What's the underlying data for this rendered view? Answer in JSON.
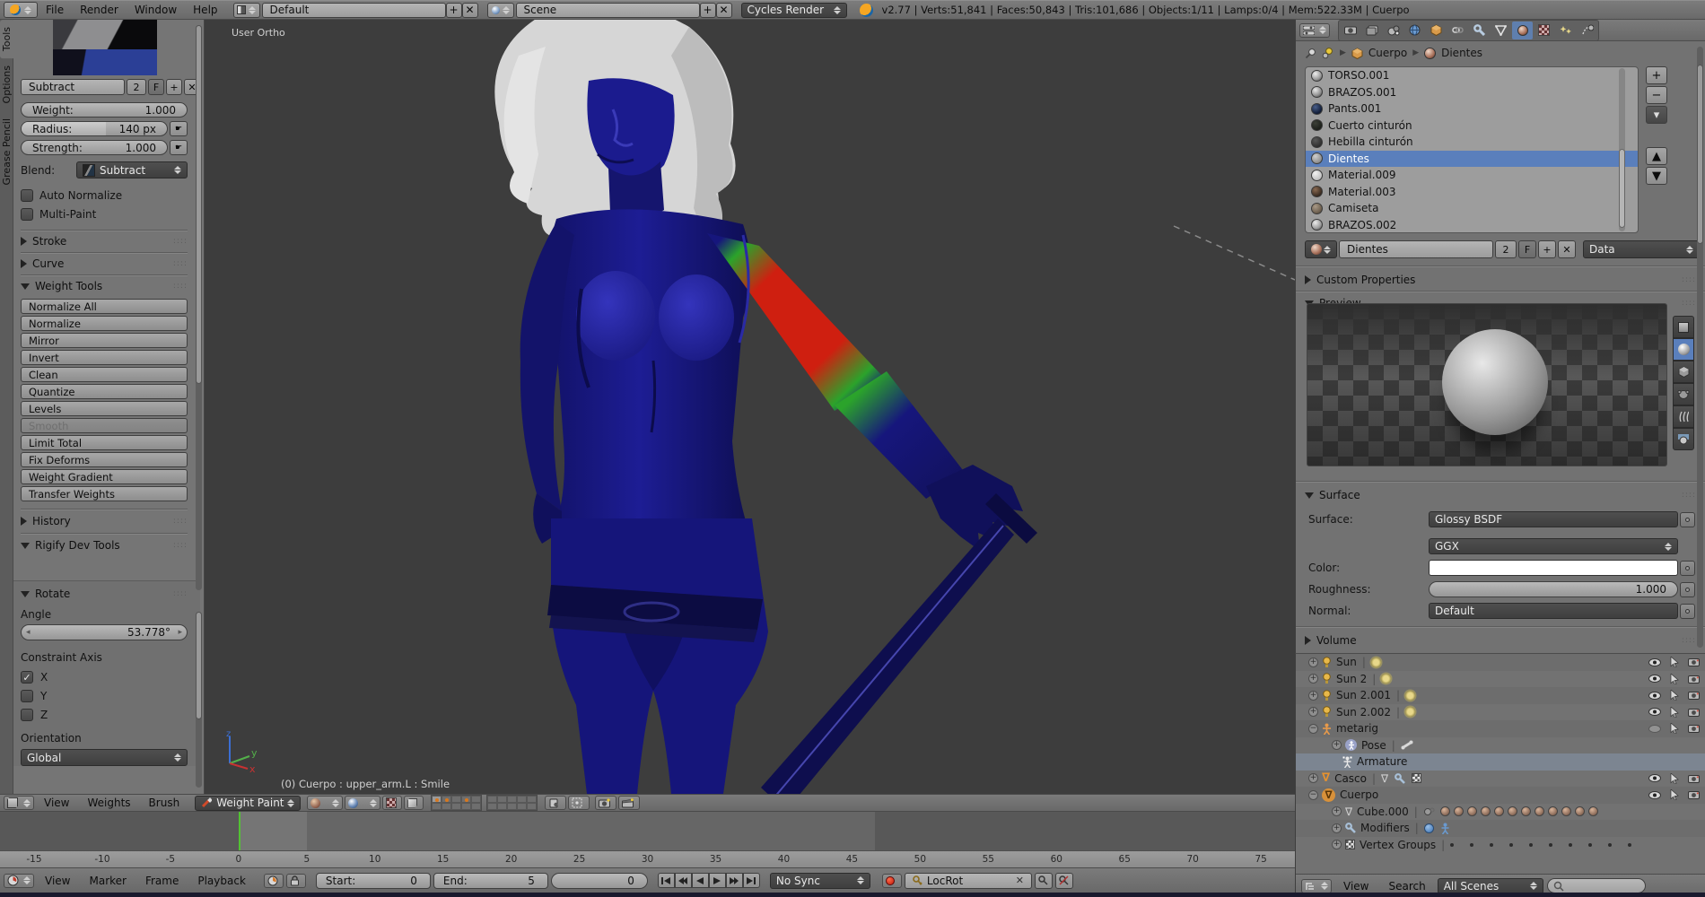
{
  "window": {
    "menus": [
      "File",
      "Render",
      "Window",
      "Help"
    ],
    "layout": "Default",
    "scene": "Scene",
    "engine": "Cycles Render",
    "stats": "v2.77 | Verts:51,841 | Faces:50,843 | Tris:101,686 | Objects:1/11 | Lamps:0/4 | Mem:522.33M | Cuerpo"
  },
  "tool_shelf": {
    "tabs": [
      "Tools",
      "Options",
      "Grease Pencil"
    ],
    "brush": {
      "name": "Subtract",
      "count": "2",
      "fake": "F",
      "weight_label": "Weight:",
      "weight": "1.000",
      "radius_label": "Radius:",
      "radius": "140 px",
      "strength_label": "Strength:",
      "strength": "1.000",
      "blend_label": "Blend:",
      "blend": "Subtract"
    },
    "auto_normalize": "Auto Normalize",
    "multi_paint": "Multi-Paint",
    "stroke": "Stroke",
    "curve": "Curve",
    "weight_tools": "Weight Tools",
    "buttons": [
      {
        "label": "Normalize All"
      },
      {
        "label": "Normalize"
      },
      {
        "label": "Mirror"
      },
      {
        "label": "Invert"
      },
      {
        "label": "Clean"
      },
      {
        "label": "Quantize"
      },
      {
        "label": "Levels"
      },
      {
        "label": "Smooth",
        "disabled": true
      },
      {
        "label": "Limit Total"
      },
      {
        "label": "Fix Deforms"
      },
      {
        "label": "Weight Gradient"
      },
      {
        "label": "Transfer Weights"
      }
    ],
    "history": "History",
    "rigify": "Rigify Dev Tools"
  },
  "operator": {
    "title": "Rotate",
    "angle_label": "Angle",
    "angle": "53.778°",
    "axis_label": "Constraint Axis",
    "x": "X",
    "y": "Y",
    "z": "Z",
    "orientation_label": "Orientation",
    "orientation": "Global"
  },
  "viewport": {
    "view": "User Ortho",
    "status": "(0) Cuerpo : upper_arm.L : Smile",
    "menus": [
      "View",
      "Weights",
      "Brush"
    ],
    "mode": "Weight Paint",
    "gizmo": {
      "x": "x",
      "y": "y",
      "z": "z"
    }
  },
  "timeline": {
    "ruler": [
      "-15",
      "-10",
      "-5",
      "0",
      "5",
      "10",
      "15",
      "20",
      "25",
      "30",
      "35",
      "40",
      "45",
      "50",
      "55",
      "60",
      "65",
      "70",
      "75"
    ],
    "menus": [
      "View",
      "Marker",
      "Frame",
      "Playback"
    ],
    "start_label": "Start:",
    "start": "0",
    "end_label": "End:",
    "end": "5",
    "frame": "0",
    "sync": "No Sync",
    "keyset": "LocRot"
  },
  "properties": {
    "breadcrumb_object": "Cuerpo",
    "breadcrumb_data": "Dientes",
    "materials": [
      {
        "name": "TORSO.001",
        "icon_color": "radial-gradient(circle at 35% 30%, #efefef, #9a9a9a 60%, #3a3a3a)"
      },
      {
        "name": "BRAZOS.001",
        "icon_color": "radial-gradient(circle at 35% 30%, #e8e8e8, #909090 60%, #333)"
      },
      {
        "name": "Pants.001",
        "icon_color": "radial-gradient(circle at 35% 30%, #4a5f8a, #14203c 65%, #0a0f1e)"
      },
      {
        "name": "Cuerto cinturón",
        "icon_color": "radial-gradient(circle at 35% 30%, #3c4038, #1d201b 70%, #101210)"
      },
      {
        "name": "Hebilla cinturón",
        "icon_color": "radial-gradient(circle at 35% 30%, #585858, #303030 70%, #1c1c1c)"
      },
      {
        "name": "Dientes",
        "icon_color": "radial-gradient(circle at 35% 30%, #cfcfcf, #8e8e8e 70%, #5a5a5a)",
        "selected": true
      },
      {
        "name": "Material.009",
        "icon_color": "radial-gradient(circle at 35% 30%, #f2f2f2, #c2c2c2 70%, #8a8a8a)"
      },
      {
        "name": "Material.003",
        "icon_color": "radial-gradient(circle at 35% 30%, #8a6a52, #3a2c22 70%, #1a140e)"
      },
      {
        "name": "Camiseta",
        "icon_color": "radial-gradient(circle at 35% 30%, #a99a88, #6a5c4c 70%, #3a3028)"
      },
      {
        "name": "BRAZOS.002",
        "icon_color": "radial-gradient(circle at 35% 30%, #ececec, #9c9c9c 60%, #3e3e3e)"
      }
    ],
    "name_field": "Dientes",
    "users": "2",
    "fake": "F",
    "link": "Data",
    "custom_properties": "Custom Properties",
    "preview": "Preview",
    "surface_title": "Surface",
    "surface_label": "Surface:",
    "surface": "Glossy BSDF",
    "distribution": "GGX",
    "color_label": "Color:",
    "roughness_label": "Roughness:",
    "roughness": "1.000",
    "normal_label": "Normal:",
    "normal": "Default",
    "volume_title": "Volume"
  },
  "outliner": {
    "rows": [
      {
        "name": "Sun"
      },
      {
        "name": "Sun 2"
      },
      {
        "name": "Sun 2.001"
      },
      {
        "name": "Sun 2.002"
      },
      {
        "name": "metarig"
      },
      {
        "name": "Pose"
      },
      {
        "name": "Armature"
      },
      {
        "name": "Casco"
      },
      {
        "name": "Cuerpo"
      },
      {
        "name": "Cube.000"
      },
      {
        "name": "Modifiers"
      },
      {
        "name": "Vertex Groups"
      }
    ],
    "menus": [
      "View",
      "Search"
    ],
    "scenes": "All Scenes"
  }
}
